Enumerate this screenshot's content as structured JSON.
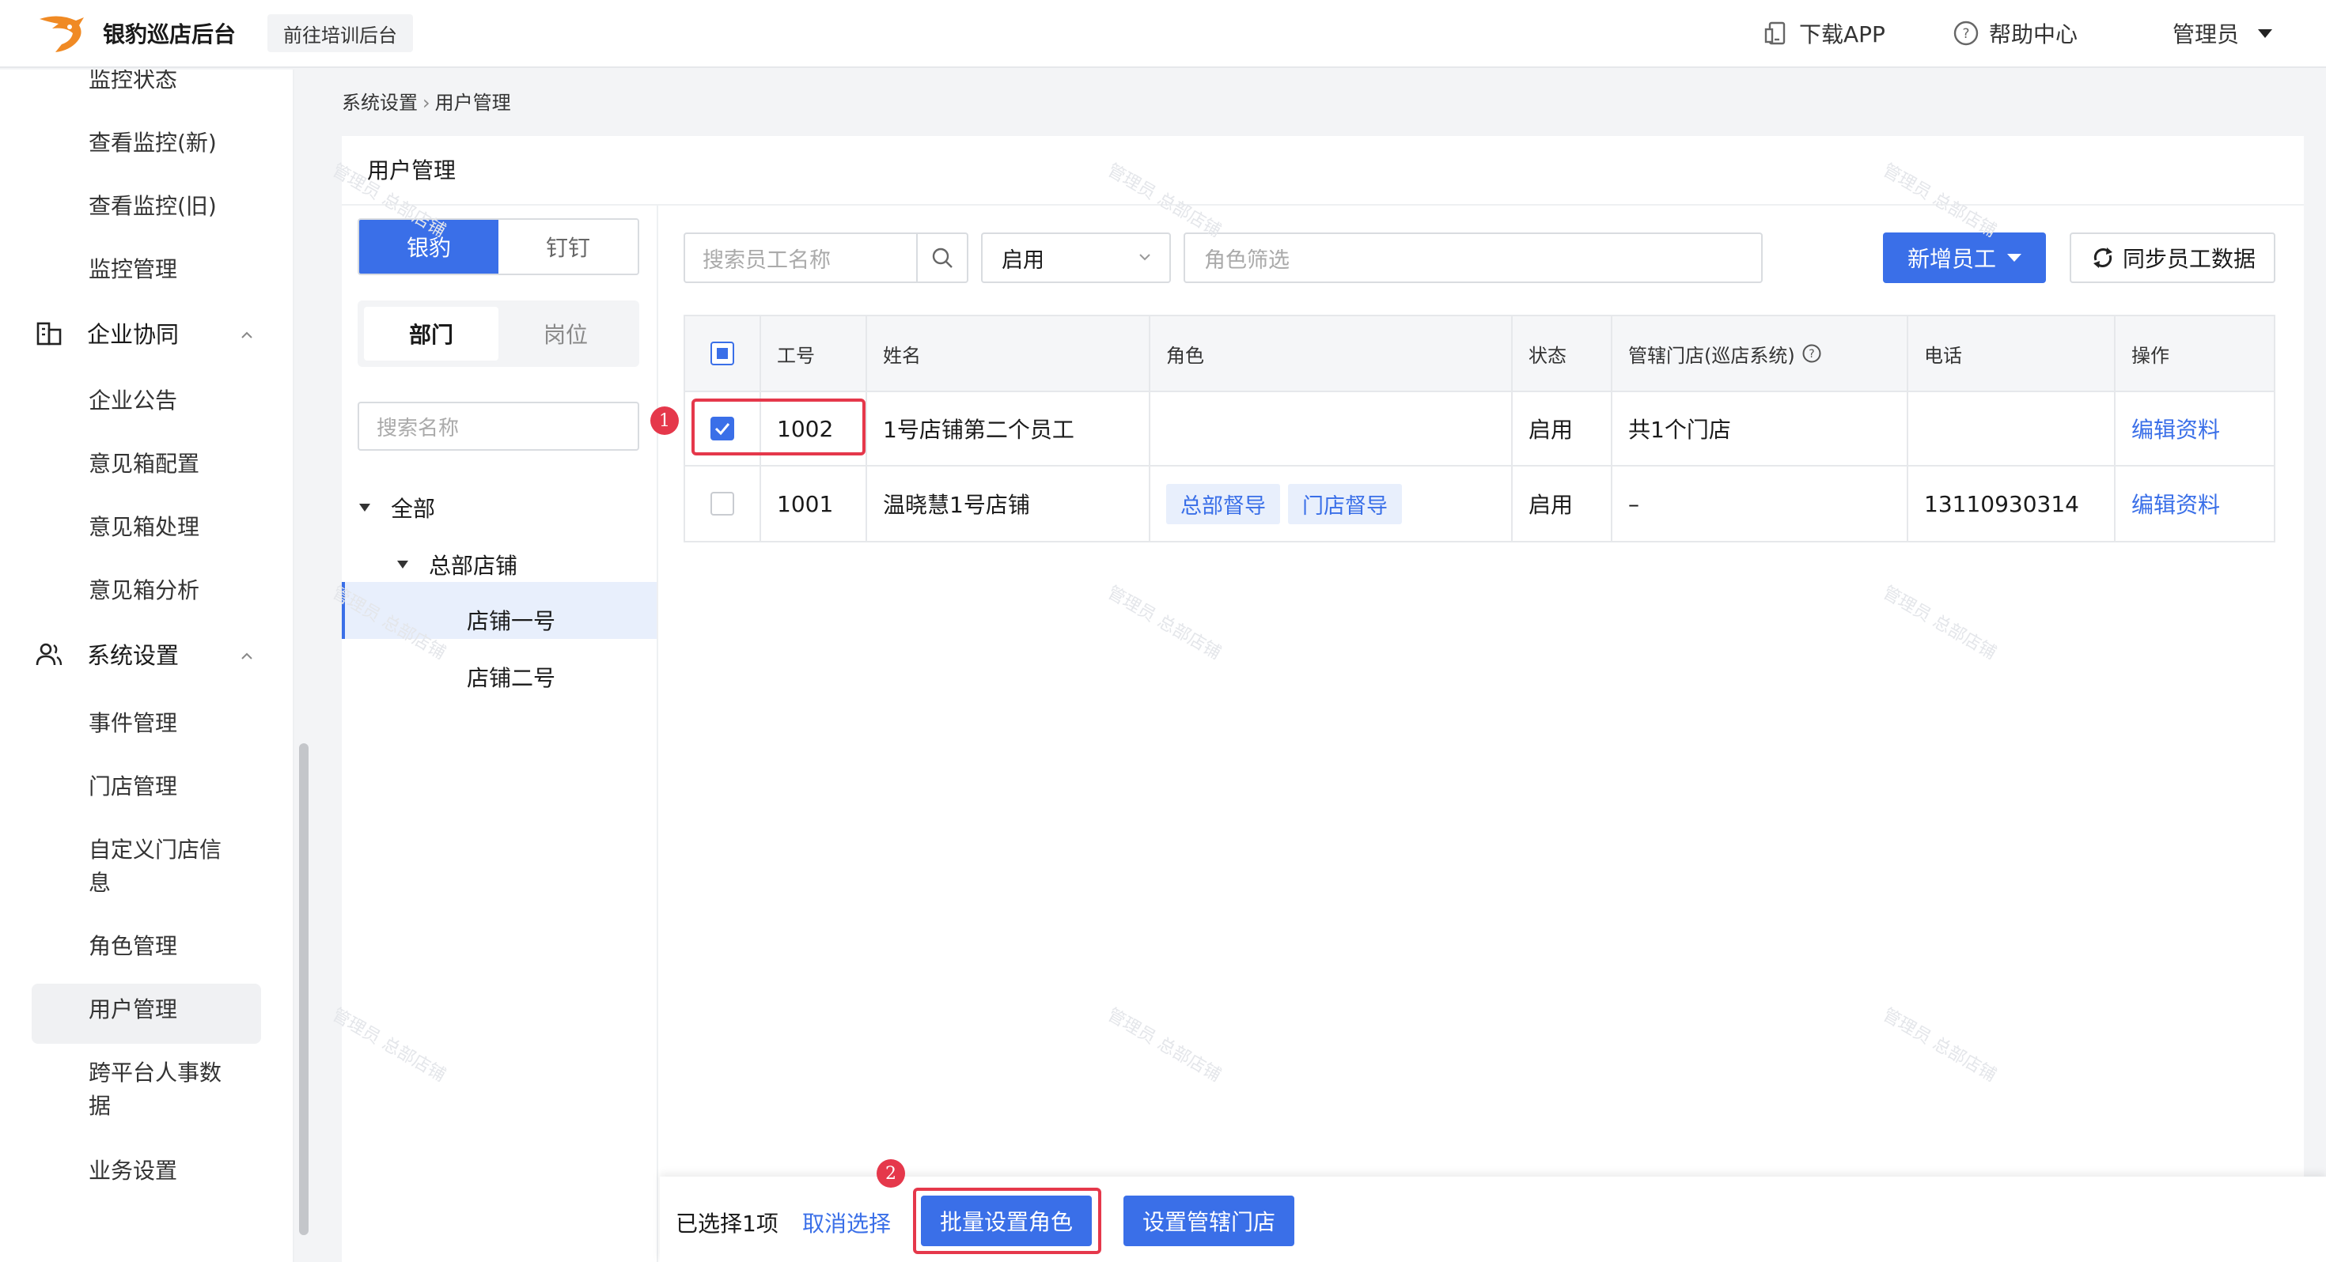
{
  "header": {
    "brand": "银豹巡店后台",
    "training_button": "前往培训后台",
    "download_app": "下载APP",
    "help_center": "帮助中心",
    "user": "管理员"
  },
  "sidebar": {
    "items_top": [
      "监控状态",
      "查看监控(新)",
      "查看监控(旧)",
      "监控管理"
    ],
    "group_collab": "企业协同",
    "collab_items": [
      "企业公告",
      "意见箱配置",
      "意见箱处理",
      "意见箱分析"
    ],
    "group_settings": "系统设置",
    "settings_items": [
      "事件管理",
      "门店管理",
      "自定义门店信息",
      "角色管理",
      "用户管理",
      "跨平台人事数据",
      "业务设置"
    ],
    "active": "用户管理"
  },
  "breadcrumb": {
    "parent": "系统设置",
    "sep": "›",
    "current": "用户管理"
  },
  "card": {
    "title": "用户管理"
  },
  "left_panel": {
    "seg_on": "银豹",
    "seg_off": "钉钉",
    "tab_on": "部门",
    "tab_off": "岗位",
    "search_placeholder": "搜索名称",
    "tree": {
      "all": "全部",
      "hq": "总部店铺",
      "store1": "店铺一号",
      "store2": "店铺二号"
    }
  },
  "toolbar": {
    "search_placeholder": "搜索员工名称",
    "status": "启用",
    "role_filter_placeholder": "角色筛选",
    "new_staff": "新增员工",
    "sync": "同步员工数据"
  },
  "table": {
    "headers": [
      "工号",
      "姓名",
      "角色",
      "状态",
      "管辖门店(巡店系统)",
      "电话",
      "操作"
    ],
    "rows": [
      {
        "id": "1002",
        "name": "1号店铺第二个员工",
        "status": "启用",
        "stores": "共1个门店",
        "phone": "",
        "action": "编辑资料",
        "checked": true
      },
      {
        "id": "1001",
        "name": "温晓慧1号店铺",
        "roles": [
          "总部督导",
          "门店督导"
        ],
        "status": "启用",
        "stores": "–",
        "phone": "13110930314",
        "action": "编辑资料",
        "checked": false
      }
    ]
  },
  "bottom_bar": {
    "selected": "已选择1项",
    "cancel": "取消选择",
    "batch_role": "批量设置角色",
    "set_stores": "设置管辖门店"
  },
  "annotations": {
    "badge1": "1",
    "badge2": "2"
  },
  "watermark": "管理员 总部店铺",
  "colors": {
    "primary": "#3a6fe8",
    "highlight": "#e5384b"
  }
}
